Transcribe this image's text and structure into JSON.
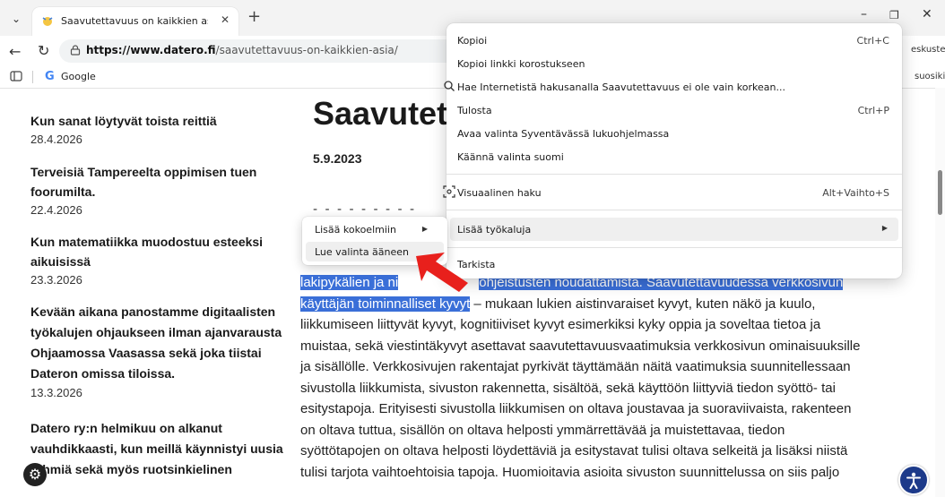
{
  "browser": {
    "tab_title": "Saavutettavuus on kaikkien asia. -",
    "url_host": "https://www.datero.fi",
    "url_path": "/saavutettavuus-on-kaikkien-asia/",
    "right_clip_top": "eskustelu",
    "right_clip_bookmarks": "suosikit",
    "bookmark_google": "Google"
  },
  "sidebar": {
    "items": [
      {
        "title": "Kun sanat löytyvät toista reittiä",
        "date": "28.4.2026"
      },
      {
        "title": "Terveisiä Tampereelta oppimisen tuen foorumilta.",
        "date": "22.4.2026"
      },
      {
        "title": "Kun matematiikka muodostuu esteeksi aikuisissä",
        "date": "23.3.2026"
      },
      {
        "title": "Kevään aikana panostamme digitaalisten työkalujen ohjaukseen ilman ajanvarausta Ohjaamossa Vaasassa sekä joka tiistai Dateron omissa tiloissa.",
        "date": "13.3.2026"
      },
      {
        "title": "Datero ry:n helmikuu on alkanut vauhdikkaasti, kun meillä käynnistyi uusia ryhmiä sekä myös ruotsinkielinen",
        "date": ""
      }
    ]
  },
  "article": {
    "title": "Saavutett",
    "date": "5.9.2023",
    "clipped_line": "- - -  - -  -  - -  -",
    "line1_sel_a": "lakipykälien ja ni",
    "line1_sel_b": "ohjeistusten noudattamista. Saavutettavuudessa verkkosivun",
    "line2_sel": "käyttäjän toiminnalliset kyvyt",
    "line2_rest": " – mukaan lukien aistinvaraiset kyvyt, kuten näkö ja kuulo,",
    "lines": [
      "liikkumiseen liittyvät kyvyt, kognitiiviset kyvyt esimerkiksi kyky oppia ja soveltaa tietoa ja",
      "muistaa, sekä viestintäkyvyt asettavat saavutettavuusvaatimuksia verkkosivun ominaisuuksille",
      "ja sisällölle. Verkkosivujen rakentajat pyrkivät täyttämään näitä vaatimuksia suunnitellessaan",
      "sivustolla liikkumista, sivuston rakennetta, sisältöä, sekä käyttöön liittyviä tiedon syöttö- tai",
      "esitystapoja. Erityisesti sivustolla liikkumisen on oltava joustavaa ja suoraviivaista, rakenteen",
      "on oltava tuttua, sisällön on oltava helposti ymmärrettävää ja muistettavaa, tiedon",
      "syöttötapojen on oltava helposti löydettäviä ja esitystavat tulisi oltava selkeitä ja lisäksi niistä",
      "tulisi tarjota vaihtoehtoisia tapoja. Huomioitavia asioita sivuston suunnittelussa on siis paljo"
    ]
  },
  "context_menu": {
    "copy": "Kopioi",
    "copy_shortcut": "Ctrl+C",
    "copy_link": "Kopioi linkki korostukseen",
    "search": "Hae Internetistä hakusanalla Saavutettavuus ei ole vain korkean...",
    "print": "Tulosta",
    "print_shortcut": "Ctrl+P",
    "immersive": "Avaa valinta Syventävässä lukuohjelmassa",
    "translate": "Käännä valinta suomi",
    "visual_search": "Visuaalinen haku",
    "visual_search_shortcut": "Alt+Vaihto+S",
    "more_tools": "Lisää työkaluja",
    "inspect": "Tarkista"
  },
  "submenu": {
    "add_to_collections": "Lisää kokoelmiin",
    "read_aloud": "Lue valinta ääneen"
  },
  "colors": {
    "selection": "#3a6fd8",
    "arrow": "#e8201c",
    "accessibility_fab": "#1d3a8a"
  }
}
